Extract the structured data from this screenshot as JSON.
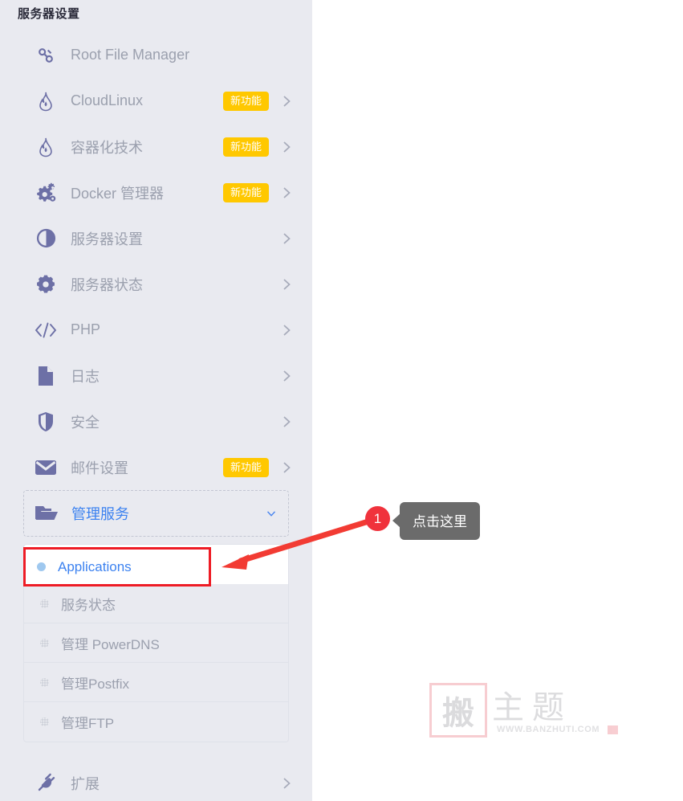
{
  "panel": {
    "title": "服务器设置",
    "accent_blue": "#3c82f0",
    "badge_yellow": "#ffc800",
    "annotation_red": "#ee1c25",
    "sidebar_bg": "#e9eaf0"
  },
  "nav": {
    "items": [
      {
        "label": "Root File Manager",
        "icon": "link-icon",
        "badge": "",
        "chevron": ""
      },
      {
        "label": "CloudLinux",
        "icon": "flame-icon",
        "badge": "新功能",
        "chevron": "chevron-right-icon"
      },
      {
        "label": "容器化技术",
        "icon": "flame-icon",
        "badge": "新功能",
        "chevron": "chevron-right-icon"
      },
      {
        "label": "Docker 管理器",
        "icon": "gears-icon",
        "badge": "新功能",
        "chevron": "chevron-right-icon"
      },
      {
        "label": "服务器设置",
        "icon": "contrast-icon",
        "badge": "",
        "chevron": "chevron-right-icon"
      },
      {
        "label": "服务器状态",
        "icon": "gear-icon",
        "badge": "",
        "chevron": "chevron-right-icon"
      },
      {
        "label": "PHP",
        "icon": "code-icon",
        "badge": "",
        "chevron": "chevron-right-icon"
      },
      {
        "label": "日志",
        "icon": "file-icon",
        "badge": "",
        "chevron": "chevron-right-icon"
      },
      {
        "label": "安全",
        "icon": "shield-icon",
        "badge": "",
        "chevron": "chevron-right-icon"
      },
      {
        "label": "邮件设置",
        "icon": "envelope-icon",
        "badge": "新功能",
        "chevron": "chevron-right-icon"
      }
    ],
    "expanded_item": {
      "label": "管理服务",
      "icon": "open-folder-icon",
      "chevron": "chevron-down-icon"
    },
    "submenu": [
      {
        "label": "Applications",
        "active": true
      },
      {
        "label": "服务状态",
        "active": false
      },
      {
        "label": "管理 PowerDNS",
        "active": false
      },
      {
        "label": "管理Postfix",
        "active": false
      },
      {
        "label": "管理FTP",
        "active": false
      }
    ],
    "tail_item": {
      "label": "扩展",
      "icon": "plug-icon",
      "chevron": "chevron-right-icon"
    }
  },
  "annotation": {
    "step_number": "1",
    "tooltip_text": "点击这里"
  },
  "watermark": {
    "seal_char": "搬",
    "main_text": "主题",
    "url": "WWW.BANZHUTI.COM"
  }
}
